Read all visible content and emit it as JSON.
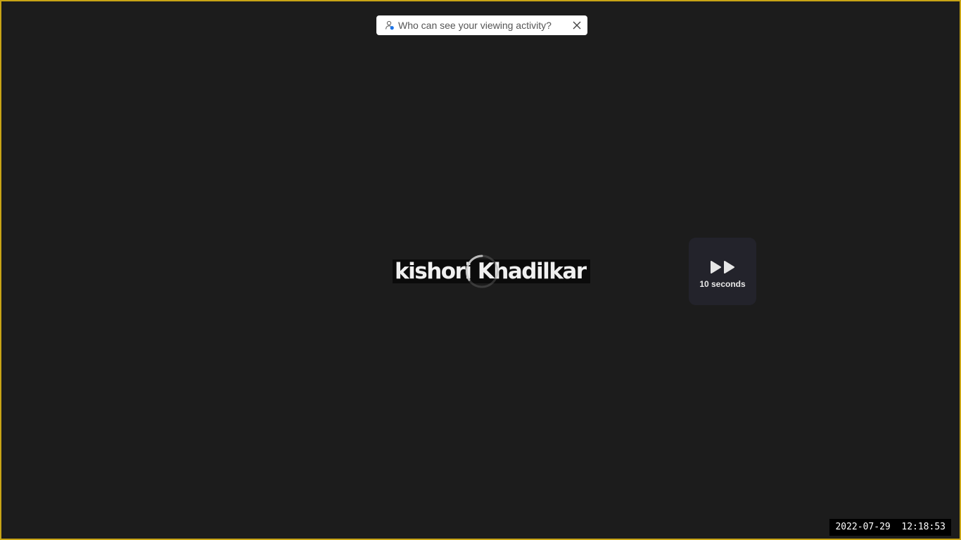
{
  "privacy_banner": {
    "icon": "person-privacy-icon",
    "text": "Who can see your viewing activity?",
    "close_icon": "close-icon"
  },
  "video": {
    "title_overlay": "kishori Khadilkar",
    "loading": true,
    "loading_icon": "spinner-icon"
  },
  "skip_button": {
    "icon": "fast-forward-icon",
    "label": "10 seconds"
  },
  "timestamp": "2022-07-29  12:18:53",
  "colors": {
    "background": "#1c1c1c",
    "frame_border": "#c8a415",
    "banner_bg": "#ffffff",
    "skip_card_bg": "#23232b",
    "accent_blue": "#1a73e8"
  }
}
